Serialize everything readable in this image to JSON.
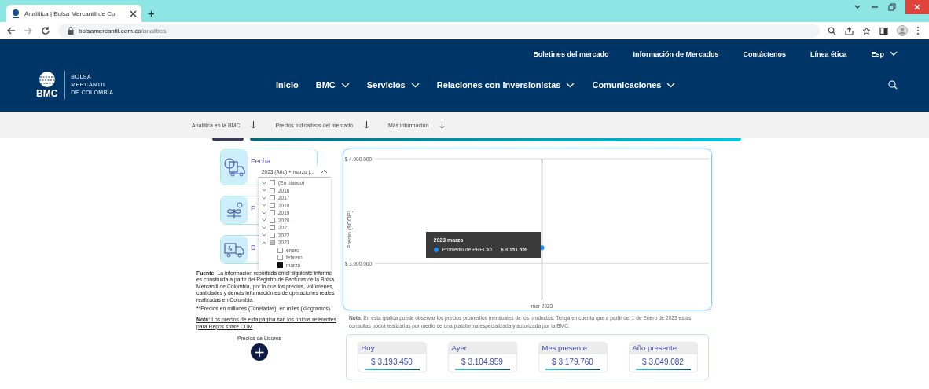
{
  "browser": {
    "tabs": [
      {
        "title": "Analítica | Bolsa Mercantil de Co",
        "selected": true
      }
    ],
    "new_tab": "+",
    "url_host": "bolsamercantil.com.co",
    "url_path": "/analitica"
  },
  "header": {
    "top_links": [
      "Boletines del mercado",
      "Información de Mercados",
      "Contáctenos",
      "Línea ética"
    ],
    "language": "Esp",
    "logo_text": "BMC",
    "logo_lines": [
      "BOLSA",
      "MERCANTIL",
      "DE COLOMBIA"
    ],
    "nav": [
      {
        "label": "Inicio",
        "dropdown": false
      },
      {
        "label": "BMC",
        "dropdown": true
      },
      {
        "label": "Servicios",
        "dropdown": true
      },
      {
        "label": "Relaciones con Inversionistas",
        "dropdown": true
      },
      {
        "label": "Comunicaciones",
        "dropdown": true
      }
    ]
  },
  "subnav": [
    "Analítica en la BMC",
    "Precios indicativos del mercado",
    "Más información"
  ],
  "slicers": [
    {
      "title": "Fecha",
      "kind": "calendar"
    },
    {
      "title": "F",
      "kind": "plant"
    },
    {
      "title": "D",
      "kind": "truck"
    }
  ],
  "dropdown": {
    "value": "2023 (Año) + marzo (...",
    "items": [
      {
        "label": "(En blanco)",
        "checked": false,
        "partial": false,
        "expanded": false
      },
      {
        "label": "2016",
        "checked": false,
        "partial": false,
        "expanded": false
      },
      {
        "label": "2017",
        "checked": false,
        "partial": false,
        "expanded": false
      },
      {
        "label": "2018",
        "checked": false,
        "partial": false,
        "expanded": false
      },
      {
        "label": "2019",
        "checked": false,
        "partial": false,
        "expanded": false
      },
      {
        "label": "2020",
        "checked": false,
        "partial": false,
        "expanded": false
      },
      {
        "label": "2021",
        "checked": false,
        "partial": false,
        "expanded": false
      },
      {
        "label": "2022",
        "checked": false,
        "partial": false,
        "expanded": false
      },
      {
        "label": "2023",
        "checked": false,
        "partial": true,
        "expanded": true,
        "children": [
          {
            "label": "enero",
            "checked": false
          },
          {
            "label": "febrero",
            "checked": false
          },
          {
            "label": "marzo",
            "checked": true
          }
        ]
      }
    ]
  },
  "source_text": "**Fuente:** La información reportada en el siguiente informe es construida a partir del Registro de Facturas de la Bolsa Mercantil de Colombia, por lo que los precios, volúmenes, cantidades y demás información es de operaciones reales realizadas en Colombia.",
  "units_text": "**Precios en millones (Toneladas), en miles (kilogramos)",
  "repos_note": "**Nota:** Los precios de esta página son los únicos referentes para Repos sobre CDM",
  "liquor_label": "Precios de Licores",
  "add_button": "+",
  "chart": {
    "chart_data": {
      "type": "line",
      "ylabel": "Precio ($COP)",
      "categories": [
        "mar 2023"
      ],
      "series": [
        {
          "name": "Promedio de PRECIO",
          "color": "#118dff",
          "values": [
            3151559
          ],
          "marker": true
        }
      ],
      "ref_lines": [
        {
          "axis": "y",
          "value": 4000000,
          "color": "#dcdcdc"
        },
        {
          "axis": "y",
          "value": 3000000,
          "color": "#dcdcdc"
        },
        {
          "axis": "x",
          "value": "mar 2023",
          "color": "#999999"
        }
      ],
      "ylim": [
        2650000,
        4000000
      ],
      "yticks": [
        {
          "value": 3000000,
          "label": "$ 3.000.000"
        },
        {
          "value": 4000000,
          "label": "$ 4.000.000"
        }
      ]
    },
    "tooltip": {
      "title": "2023 marzo",
      "value": "$ 3.151.559"
    }
  },
  "chart_note": "**Nota**: En esta grafica puede observar los precios promedios mensuales de los productos. Tenga en cuenta que a partir del 1 de Enero de 2023 estas consultas podrá realizarlas por medio de una plataforma especializada y autorizada por la BMC.",
  "kpis": [
    {
      "label": "Hoy",
      "value": "$ 3.193.450"
    },
    {
      "label": "Ayer",
      "value": "$ 3.104.959"
    },
    {
      "label": "Mes presente",
      "value": "$ 3.179.760"
    },
    {
      "label": "Año presente",
      "value": "$ 3.049.082"
    }
  ]
}
